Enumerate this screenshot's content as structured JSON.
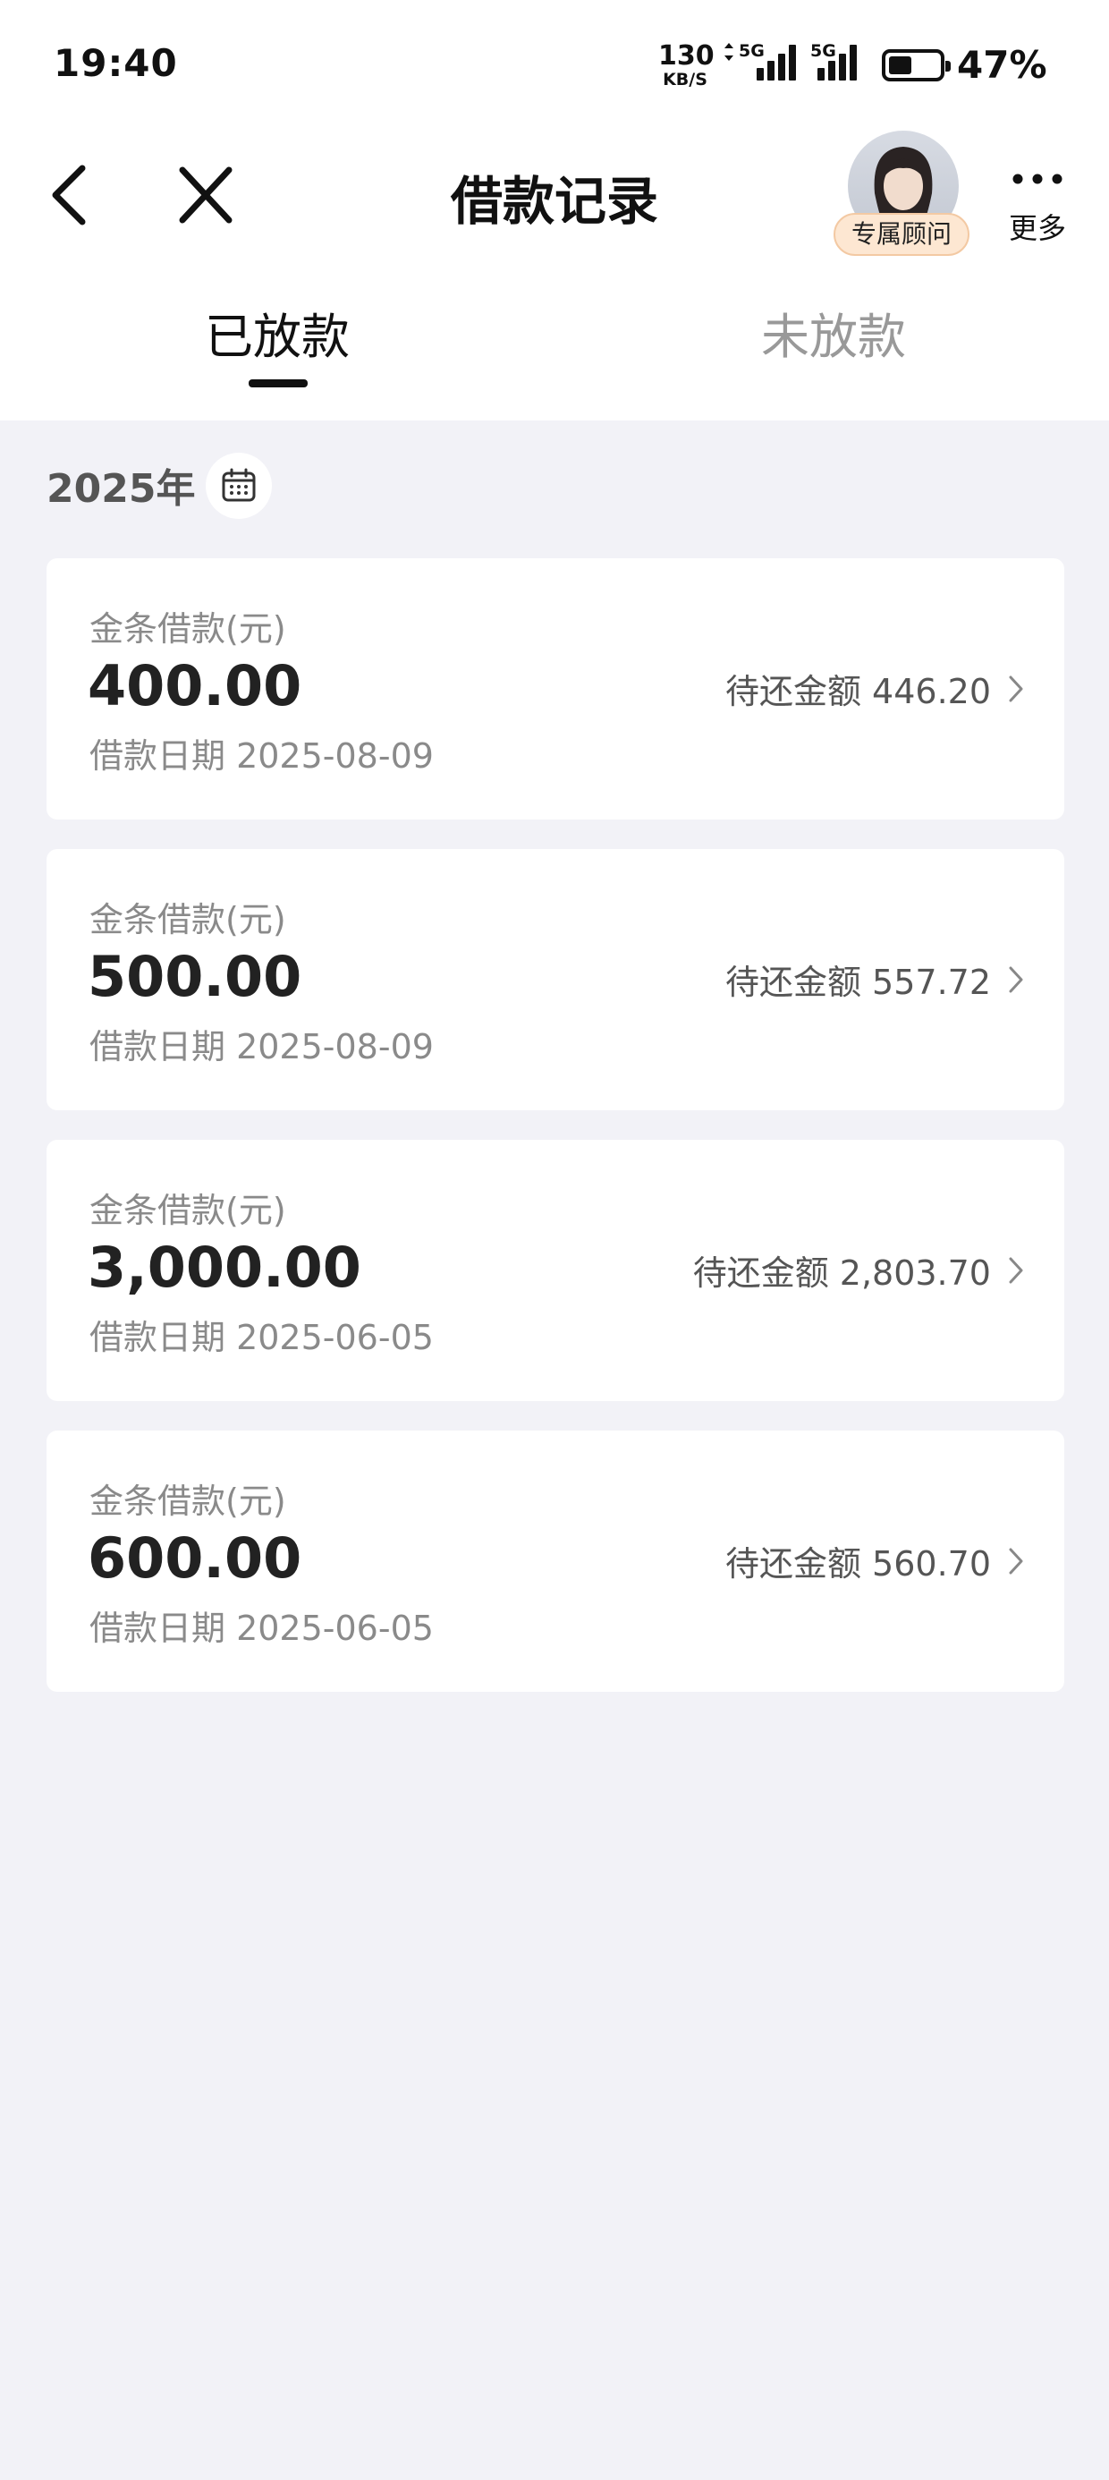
{
  "status_bar": {
    "time": "19:40",
    "net_speed_value": "130",
    "net_speed_unit": "KB/S",
    "signal_1_label": "5G",
    "signal_2_label": "5G",
    "battery_percent": "47%",
    "battery_level": 0.47
  },
  "header": {
    "title": "借款记录",
    "advisor_label": "专属顾问",
    "more_label": "更多"
  },
  "tabs": [
    {
      "label": "已放款",
      "active": true
    },
    {
      "label": "未放款",
      "active": false
    }
  ],
  "year": "2025年",
  "records": [
    {
      "label": "金条借款(元)",
      "amount": "400.00",
      "date": "借款日期 2025-08-09",
      "due": "待还金额 446.20"
    },
    {
      "label": "金条借款(元)",
      "amount": "500.00",
      "date": "借款日期 2025-08-09",
      "due": "待还金额 557.72"
    },
    {
      "label": "金条借款(元)",
      "amount": "3,000.00",
      "date": "借款日期 2025-06-05",
      "due": "待还金额 2,803.70"
    },
    {
      "label": "金条借款(元)",
      "amount": "600.00",
      "date": "借款日期 2025-06-05",
      "due": "待还金额 560.70"
    }
  ],
  "colors": {
    "page_background": "#f2f2f7",
    "card_background": "#ffffff",
    "advisor_badge": "#fde7d2",
    "muted_text": "#8a8a8a"
  },
  "icons": [
    "back-arrow-icon",
    "close-icon",
    "more-dots-icon",
    "calendar-icon",
    "chevron-right-icon"
  ]
}
